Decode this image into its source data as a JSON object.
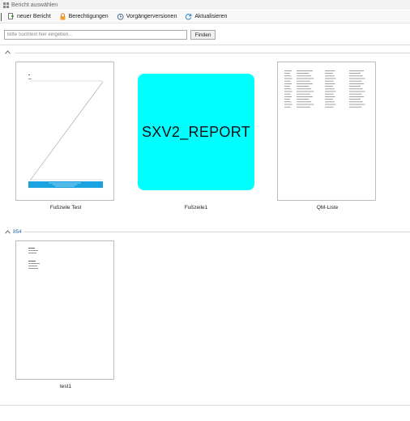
{
  "window": {
    "title": "Bericht auswählen"
  },
  "toolbar": {
    "new_report": "neuer Bericht",
    "permissions": "Berechtigungen",
    "previous_versions": "Vorgängerversionen",
    "refresh": "Aktualisieren"
  },
  "search": {
    "placeholder": "Bitte Suchtext hier eingeben...",
    "value": "",
    "find_label": "Finden"
  },
  "groups": [
    {
      "name": "",
      "reports": [
        {
          "label": "Fußzeile Test",
          "thumbnail": "page-with-diagonal-lines"
        },
        {
          "label": "Fußzeile1",
          "thumbnail": "SXV2_REPORT"
        },
        {
          "label": "QM-Liste",
          "thumbnail": "page-with-table"
        }
      ]
    },
    {
      "name": "854",
      "reports": [
        {
          "label": "test1",
          "thumbnail": "page-with-text-blocks"
        }
      ]
    }
  ],
  "colors": {
    "accent": "#2e6aa8",
    "preview_cyan": "#00ffff",
    "footer_blue": "#1aa3e0"
  }
}
